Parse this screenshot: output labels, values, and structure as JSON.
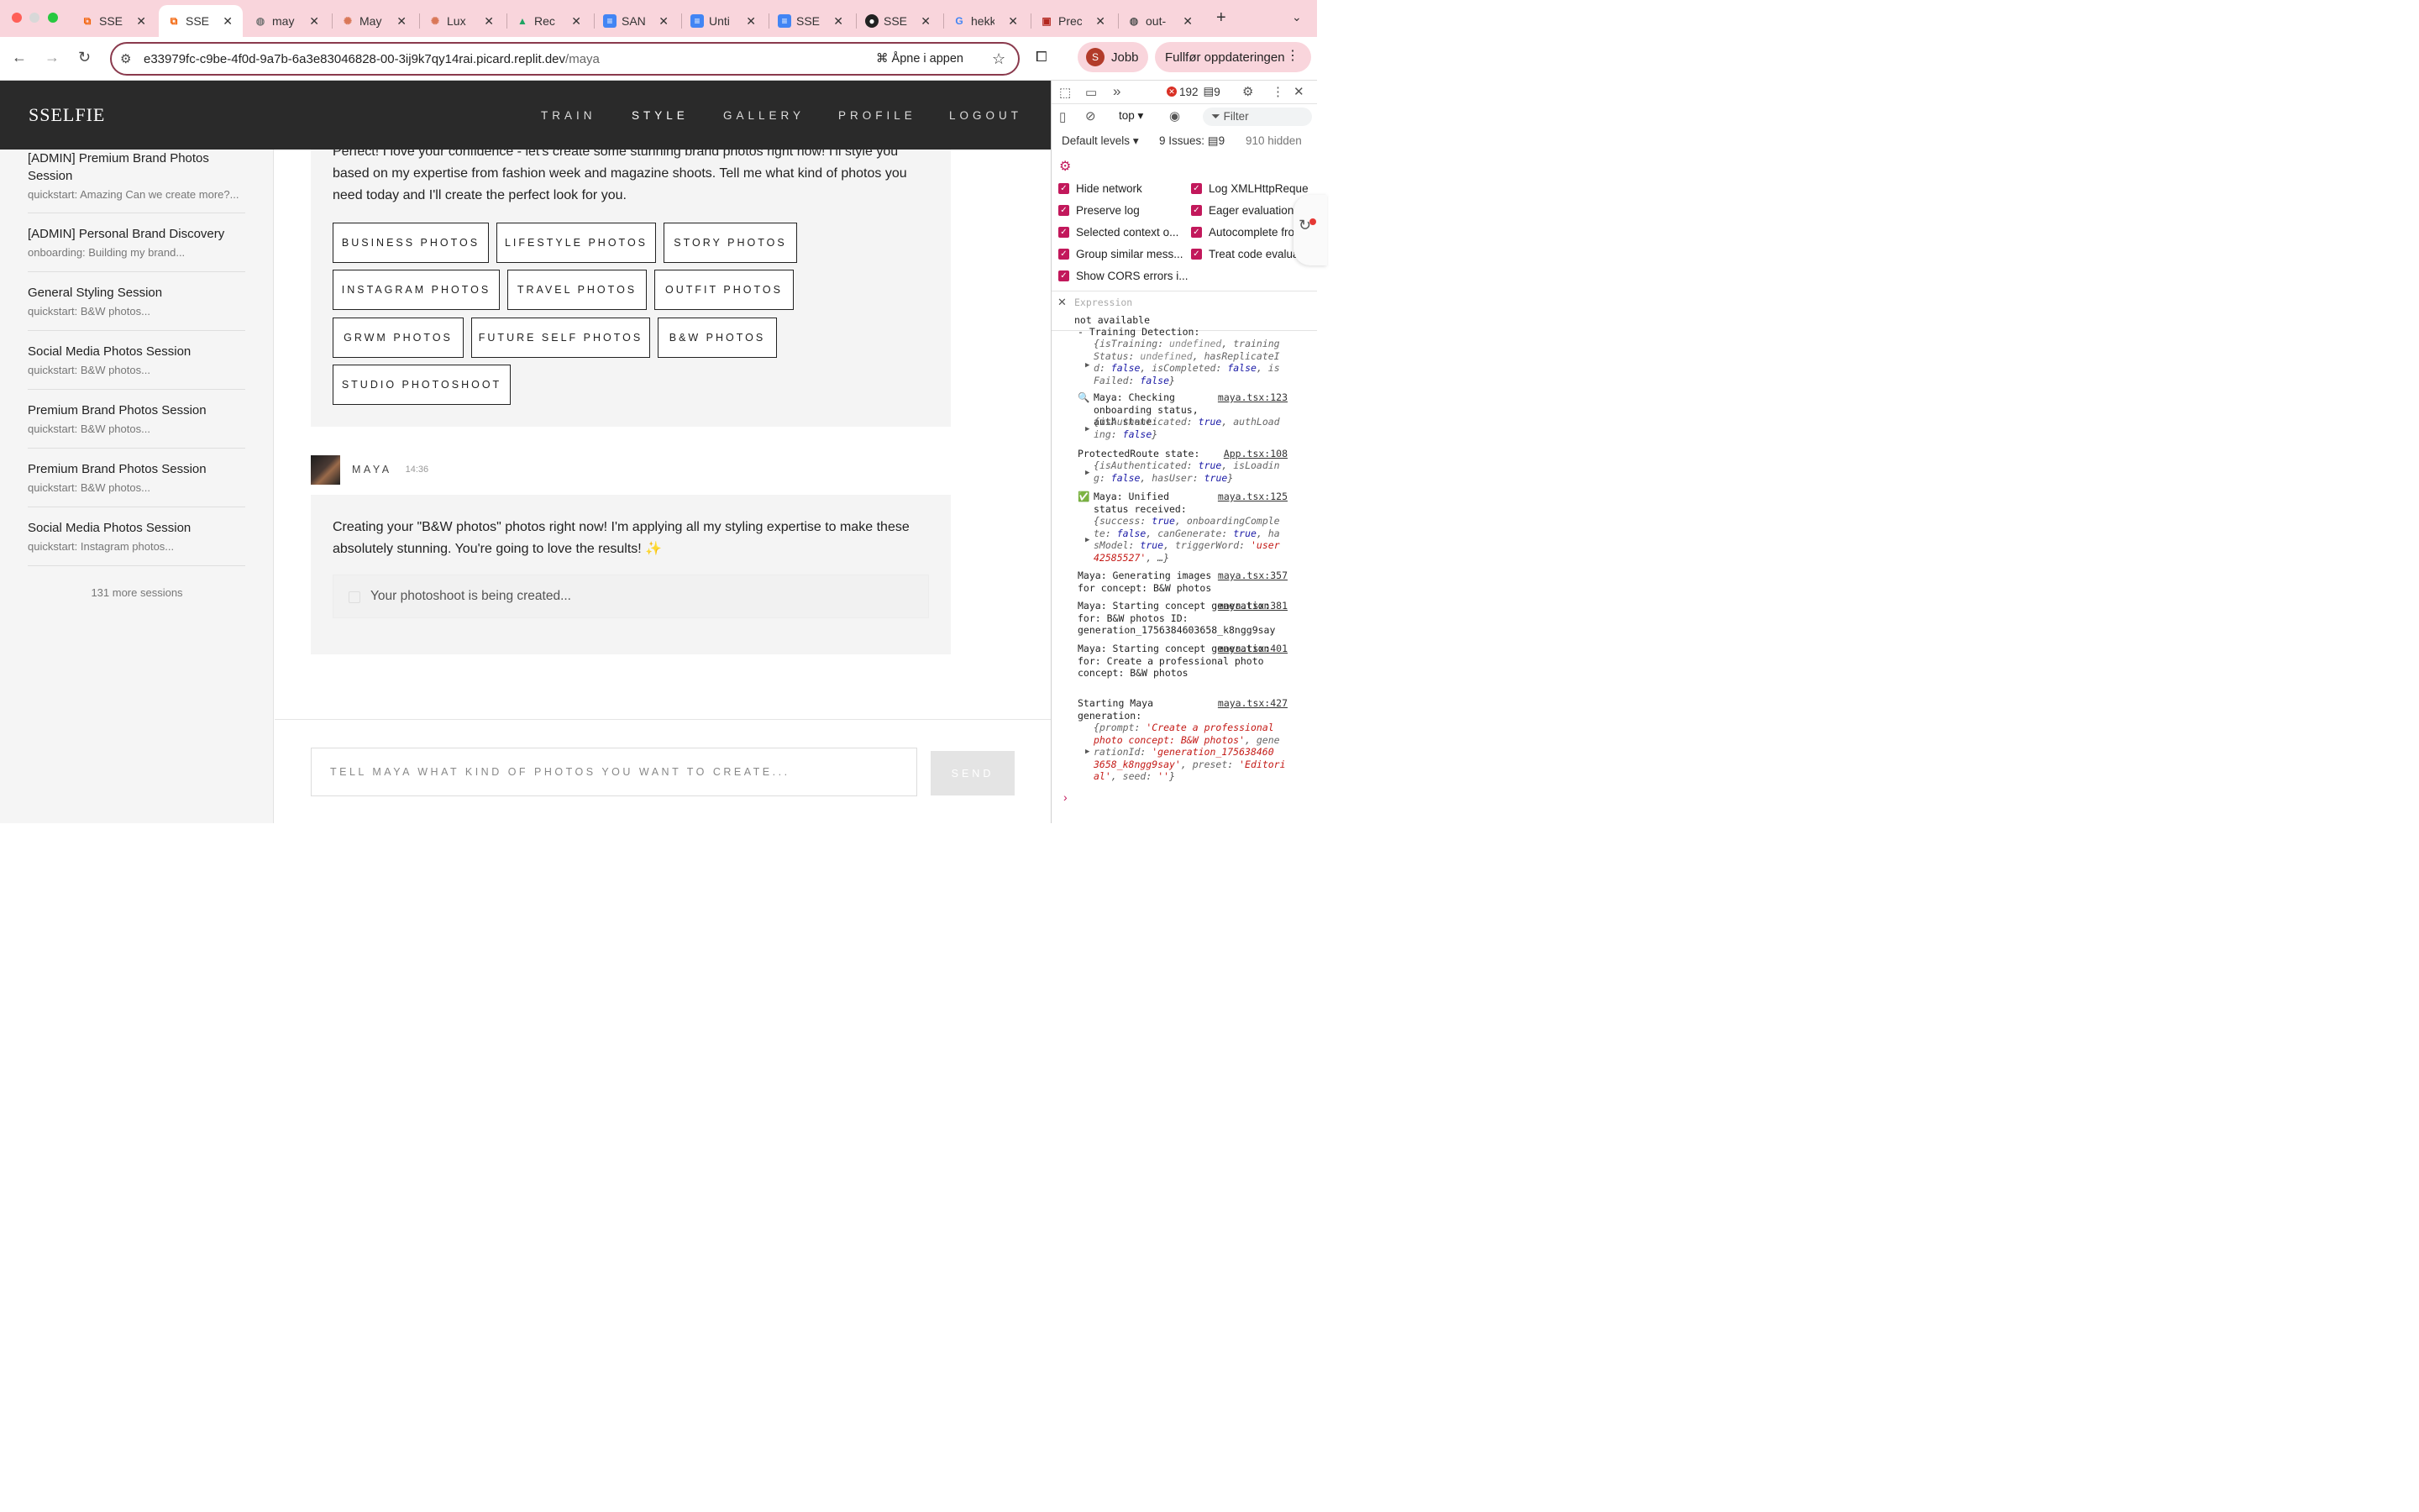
{
  "browser": {
    "tabs": [
      {
        "title": "SSE",
        "icon": "replit-icon"
      },
      {
        "title": "SSE",
        "icon": "replit-icon",
        "active": true
      },
      {
        "title": "may",
        "icon": "globe-icon"
      },
      {
        "title": "May",
        "icon": "claude-icon"
      },
      {
        "title": "Lux",
        "icon": "claude-icon"
      },
      {
        "title": "Rec",
        "icon": "drive-icon"
      },
      {
        "title": "SAN",
        "icon": "docs-icon"
      },
      {
        "title": "Unti",
        "icon": "docs-icon"
      },
      {
        "title": "SSE",
        "icon": "docs-icon"
      },
      {
        "title": "SSE",
        "icon": "github-icon"
      },
      {
        "title": "hekk",
        "icon": "google-icon"
      },
      {
        "title": "Prec",
        "icon": "pinboard-icon"
      },
      {
        "title": "out-",
        "icon": "globe-icon"
      }
    ],
    "url_main": "e33979fc-c9be-4f0d-9a7b-6a3e83046828-00-3ij9k7qy14rai.picard.replit.dev",
    "url_path": "/maya",
    "open_in_app": "Åpne i appen",
    "profile_initial": "S",
    "profile_label": "Jobb",
    "update_label": "Fullfør oppdateringen"
  },
  "app": {
    "brand": "SSELFIE",
    "nav": [
      "TRAIN",
      "STYLE",
      "GALLERY",
      "PROFILE",
      "LOGOUT"
    ],
    "sidebar": {
      "sessions": [
        {
          "title": "[ADMIN] Premium Brand Photos Session",
          "sub": "quickstart: Amazing Can we create more?..."
        },
        {
          "title": "[ADMIN] Personal Brand Discovery",
          "sub": "onboarding: Building my brand..."
        },
        {
          "title": "General Styling Session",
          "sub": "quickstart: B&W photos..."
        },
        {
          "title": "Social Media Photos Session",
          "sub": "quickstart: B&W photos..."
        },
        {
          "title": "Premium Brand Photos Session",
          "sub": "quickstart: B&W photos..."
        },
        {
          "title": "Premium Brand Photos Session",
          "sub": "quickstart: B&W photos..."
        },
        {
          "title": "Social Media Photos Session",
          "sub": "quickstart: Instagram photos..."
        }
      ],
      "more": "131 more sessions"
    },
    "chat": {
      "msg1_text": "Perfect! I love your confidence - let's create some stunning brand photos right now! I'll style you based on my expertise from fashion week and magazine shoots. Tell me what kind of photos you need today and I'll create the perfect look for you.",
      "concepts": [
        "BUSINESS PHOTOS",
        "LIFESTYLE PHOTOS",
        "STORY PHOTOS",
        "INSTAGRAM PHOTOS",
        "TRAVEL PHOTOS",
        "OUTFIT PHOTOS",
        "GRWM PHOTOS",
        "FUTURE SELF PHOTOS",
        "B&W PHOTOS",
        "STUDIO PHOTOSHOOT"
      ],
      "sender": "MAYA",
      "time": "14:36",
      "msg2_text": "Creating your \"B&W photos\" photos right now! I'm applying all my styling expertise to make these absolutely stunning. You're going to love the results! ✨",
      "creating": "Your photoshoot is being created...",
      "input_placeholder": "TELL MAYA WHAT KIND OF PHOTOS YOU WANT TO CREATE...",
      "send": "SEND"
    }
  },
  "devtools": {
    "errors": "192",
    "warnings": "9",
    "context": "top",
    "filter": "Filter",
    "levels": "Default levels",
    "issues_label": "9 Issues:",
    "issues_count": "9",
    "hidden": "910 hidden",
    "settings": [
      "Hide network",
      "Log XMLHttpReque",
      "Preserve log",
      "Eager evaluation",
      "Selected context o...",
      "Autocomplete fro",
      "Group similar mess...",
      "Treat code evalua",
      "Show CORS errors i..."
    ],
    "expression_label": "Expression",
    "expression_value": "not available",
    "logs": {
      "training_head": "- Training Detection:",
      "l1_msg": "Maya: Checking onboarding status, auth state:",
      "l1_src": "maya.tsx:123",
      "l2_msg": "ProtectedRoute state:",
      "l2_src": "App.tsx:108",
      "l3_msg": "Maya: Unified status received:",
      "l3_src": "maya.tsx:125",
      "l4_msg": "Maya: Generating images for concept: B&W photos",
      "l4_src": "maya.tsx:357",
      "l5_msg": "Maya: Starting concept generation for: B&W photos ID: generation_1756384603658_k8ngg9say",
      "l5_src": "maya.tsx:381",
      "l6_msg": "Maya: Starting concept generation for: Create a professional photo concept: B&W photos",
      "l6_src": "maya.tsx:401",
      "l7_msg": "Starting Maya generation:",
      "l7_src": "maya.tsx:427"
    }
  }
}
